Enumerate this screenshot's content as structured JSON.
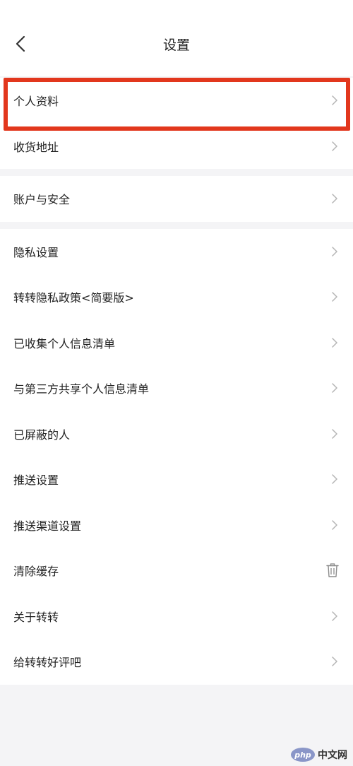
{
  "header": {
    "title": "设置",
    "back_icon": "chevron-left-icon"
  },
  "groups": [
    {
      "items": [
        {
          "label": "个人资料",
          "trailing": "chevron-right-icon",
          "highlighted": true
        },
        {
          "label": "收货地址",
          "trailing": "chevron-right-icon"
        }
      ]
    },
    {
      "items": [
        {
          "label": "账户与安全",
          "trailing": "chevron-right-icon"
        }
      ]
    },
    {
      "items": [
        {
          "label": "隐私设置",
          "trailing": "chevron-right-icon"
        },
        {
          "label": "转转隐私政策<简要版>",
          "trailing": "chevron-right-icon"
        },
        {
          "label": "已收集个人信息清单",
          "trailing": "chevron-right-icon"
        },
        {
          "label": "与第三方共享个人信息清单",
          "trailing": "chevron-right-icon"
        },
        {
          "label": "已屏蔽的人",
          "trailing": "chevron-right-icon"
        },
        {
          "label": "推送设置",
          "trailing": "chevron-right-icon"
        },
        {
          "label": "推送渠道设置",
          "trailing": "chevron-right-icon"
        },
        {
          "label": "清除缓存",
          "trailing": "trash-icon"
        },
        {
          "label": "关于转转",
          "trailing": "chevron-right-icon"
        },
        {
          "label": "给转转好评吧",
          "trailing": "chevron-right-icon"
        }
      ]
    }
  ],
  "watermark": {
    "logo_text": "php",
    "site_text": "中文网"
  },
  "colors": {
    "highlight_border": "#e2371d",
    "background": "#f4f4f6",
    "chevron": "#b5b5b5"
  }
}
